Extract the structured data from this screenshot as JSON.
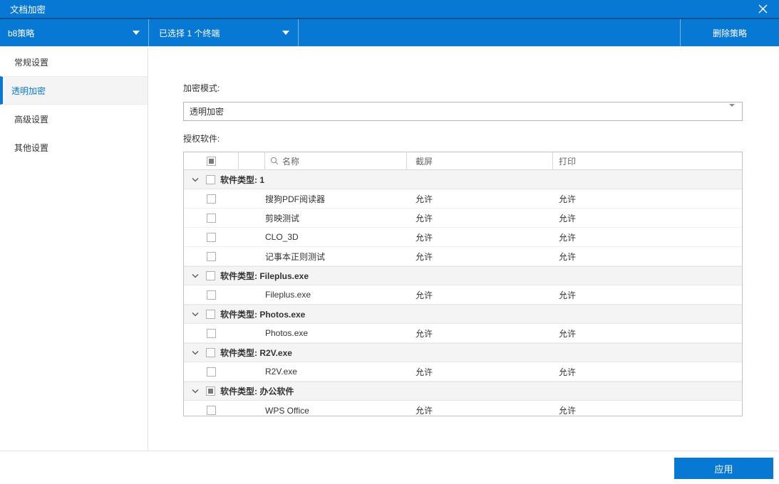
{
  "titlebar": {
    "title": "文档加密"
  },
  "toolbar": {
    "policy_dropdown": {
      "value": "b8策略"
    },
    "terminal_dropdown": {
      "value": "已选择 1 个终端"
    },
    "delete_button_label": "删除策略"
  },
  "sidebar": {
    "items": [
      {
        "label": "常规设置",
        "selected": false
      },
      {
        "label": "透明加密",
        "selected": true
      },
      {
        "label": "高级设置",
        "selected": false
      },
      {
        "label": "其他设置",
        "selected": false
      }
    ]
  },
  "content": {
    "encryption_mode": {
      "label": "加密模式:",
      "value": "透明加密"
    },
    "authorized_software": {
      "label": "授权软件:"
    },
    "table": {
      "header": {
        "select_all_state": "indeterminate",
        "name": "名称",
        "screenshot": "截屏",
        "print": "打印"
      },
      "groups": [
        {
          "label": "软件类型: 1",
          "checkbox_state": "unchecked",
          "rows": [
            {
              "checked": false,
              "name": "搜狗PDF阅读器",
              "screenshot": "允许",
              "print": "允许"
            },
            {
              "checked": false,
              "name": "剪映测试",
              "screenshot": "允许",
              "print": "允许"
            },
            {
              "checked": false,
              "name": "CLO_3D",
              "screenshot": "允许",
              "print": "允许"
            },
            {
              "checked": false,
              "name": "记事本正则测试",
              "screenshot": "允许",
              "print": "允许"
            }
          ]
        },
        {
          "label": "软件类型: Fileplus.exe",
          "checkbox_state": "unchecked",
          "rows": [
            {
              "checked": false,
              "name": "Fileplus.exe",
              "screenshot": "允许",
              "print": "允许"
            }
          ]
        },
        {
          "label": "软件类型: Photos.exe",
          "checkbox_state": "unchecked",
          "rows": [
            {
              "checked": false,
              "name": "Photos.exe",
              "screenshot": "允许",
              "print": "允许"
            }
          ]
        },
        {
          "label": "软件类型: R2V.exe",
          "checkbox_state": "unchecked",
          "rows": [
            {
              "checked": false,
              "name": "R2V.exe",
              "screenshot": "允许",
              "print": "允许"
            }
          ]
        },
        {
          "label": "软件类型: 办公软件",
          "checkbox_state": "indeterminate",
          "rows": [
            {
              "checked": false,
              "name": "WPS Office",
              "screenshot": "允许",
              "print": "允许",
              "clipped": true
            }
          ]
        }
      ]
    }
  },
  "footer": {
    "apply_button_label": "应用"
  },
  "colors": {
    "primary_blue": "#0778d4",
    "titlebar_divider": "#0a5190",
    "selected_item_bg": "#f4f4f4",
    "group_header_bg": "#f4f4f4",
    "table_border": "#c2c2c2"
  }
}
